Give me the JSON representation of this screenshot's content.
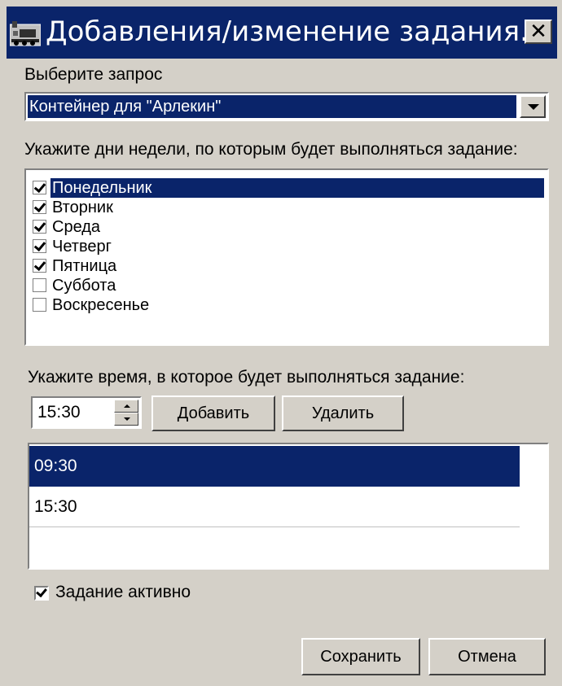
{
  "window": {
    "title": "Добавления/изменение задания...",
    "close_glyph": "✕",
    "icon": "app-train-icon"
  },
  "query": {
    "label": "Выберите запрос",
    "selected": "Контейнер для \"Арлекин\""
  },
  "days": {
    "label": "Укажите дни недели, по которым будет выполняться задание:",
    "items": [
      {
        "label": "Понедельник",
        "checked": true,
        "selected": true
      },
      {
        "label": "Вторник",
        "checked": true,
        "selected": false
      },
      {
        "label": "Среда",
        "checked": true,
        "selected": false
      },
      {
        "label": "Четверг",
        "checked": true,
        "selected": false
      },
      {
        "label": "Пятница",
        "checked": true,
        "selected": false
      },
      {
        "label": "Суббота",
        "checked": false,
        "selected": false
      },
      {
        "label": "Воскресенье",
        "checked": false,
        "selected": false
      }
    ]
  },
  "time": {
    "label": "Укажите время, в которое будет выполняться задание:",
    "value": "15:30",
    "add_label": "Добавить",
    "delete_label": "Удалить",
    "list": [
      "09:30",
      "15:30"
    ]
  },
  "active": {
    "label": "Задание активно",
    "checked": true
  },
  "buttons": {
    "save_label": "Сохранить",
    "cancel_label": "Отмена"
  },
  "colors": {
    "titlebar": "#0a246a",
    "face": "#d4d0c8",
    "selection": "#0a246a"
  }
}
